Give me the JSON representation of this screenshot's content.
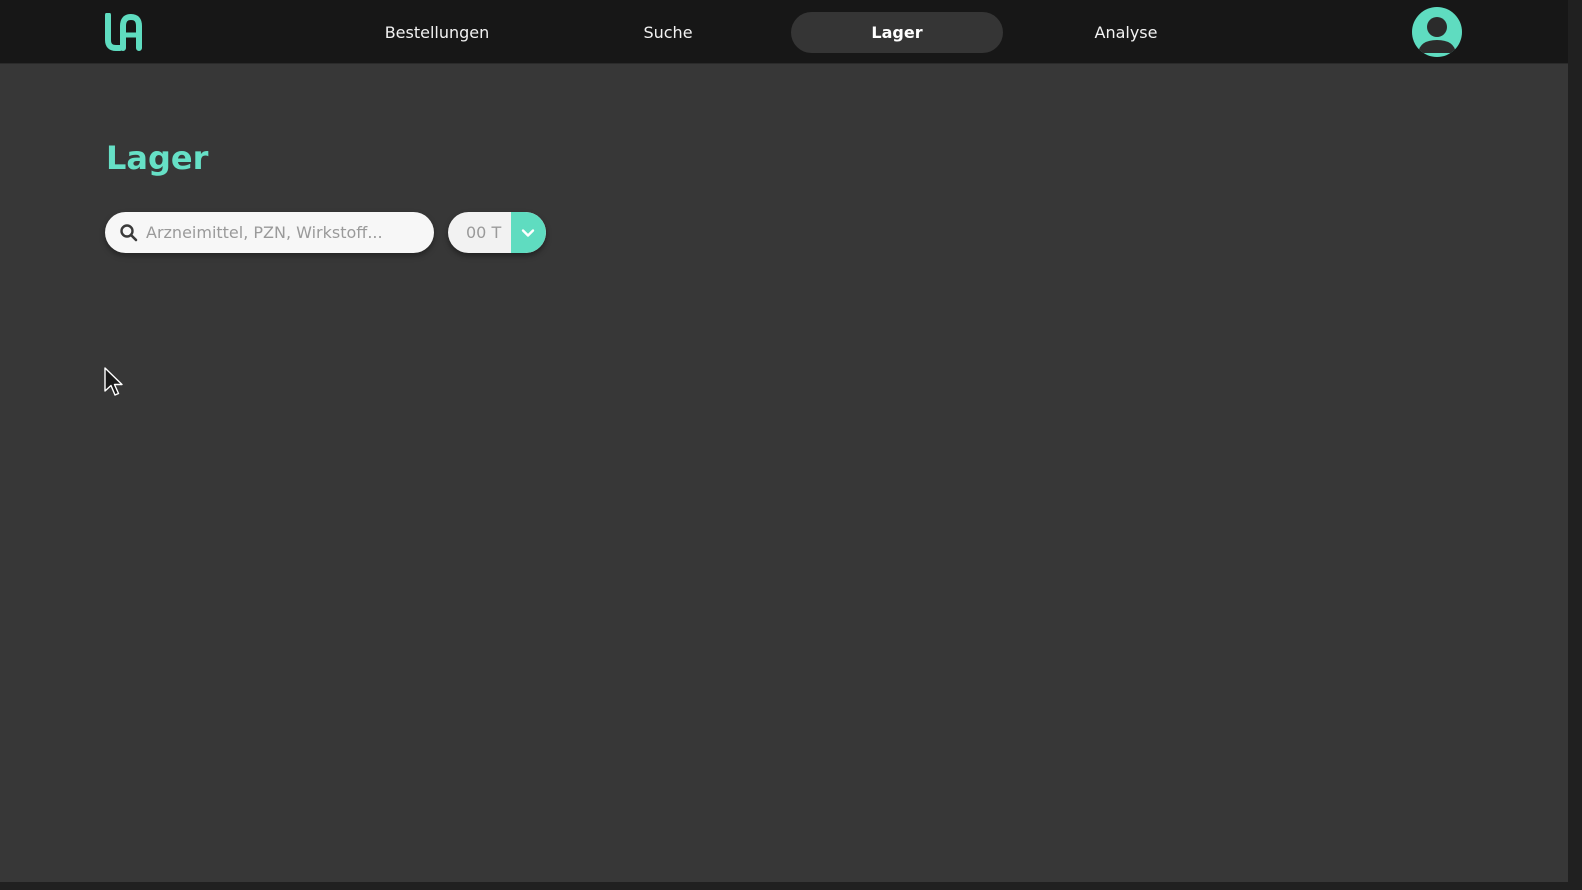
{
  "nav": {
    "items": [
      {
        "label": "Bestellungen"
      },
      {
        "label": "Suche"
      },
      {
        "label": "Lager"
      },
      {
        "label": "Analyse"
      }
    ],
    "active": "Lager"
  },
  "page": {
    "title": "Lager"
  },
  "search": {
    "placeholder": "Arzneimittel, PZN, Wirkstoff...",
    "value": ""
  },
  "range_select": {
    "value": "00 T"
  },
  "icons": {
    "logo": "la-logo",
    "avatar": "user-icon",
    "search": "search-icon",
    "dropdown": "chevron-down-icon"
  },
  "colors": {
    "accent": "#5fdcc0",
    "title": "#66e0c6",
    "topbar": "#171717",
    "background": "#373737",
    "active_pill": "#353535"
  }
}
